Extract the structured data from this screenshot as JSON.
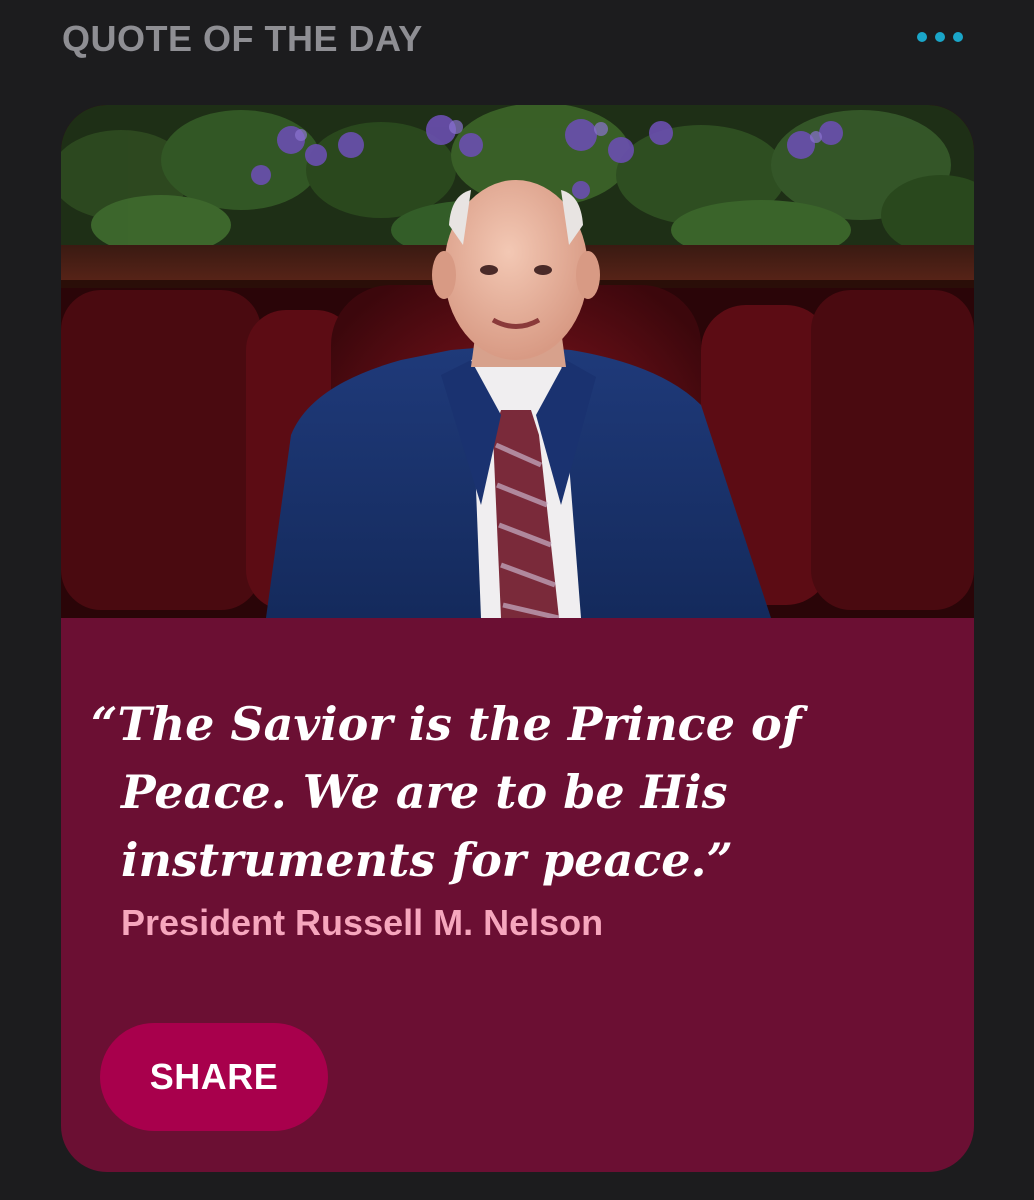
{
  "header": {
    "title": "QUOTE OF THE DAY",
    "more_icon": "more-horizontal-icon",
    "more_color": "#1aa6c9"
  },
  "card": {
    "background_color": "#6b0f33",
    "photo": {
      "subject": "portrait-photo"
    },
    "quote": {
      "text": "“The Savior is the Prince of Peace. We are to be His instruments for peace.”",
      "attribution": "President Russell M. Nelson",
      "attribution_color": "#f6a6bd"
    },
    "share_button": {
      "label": "SHARE",
      "color": "#a8004c"
    }
  }
}
